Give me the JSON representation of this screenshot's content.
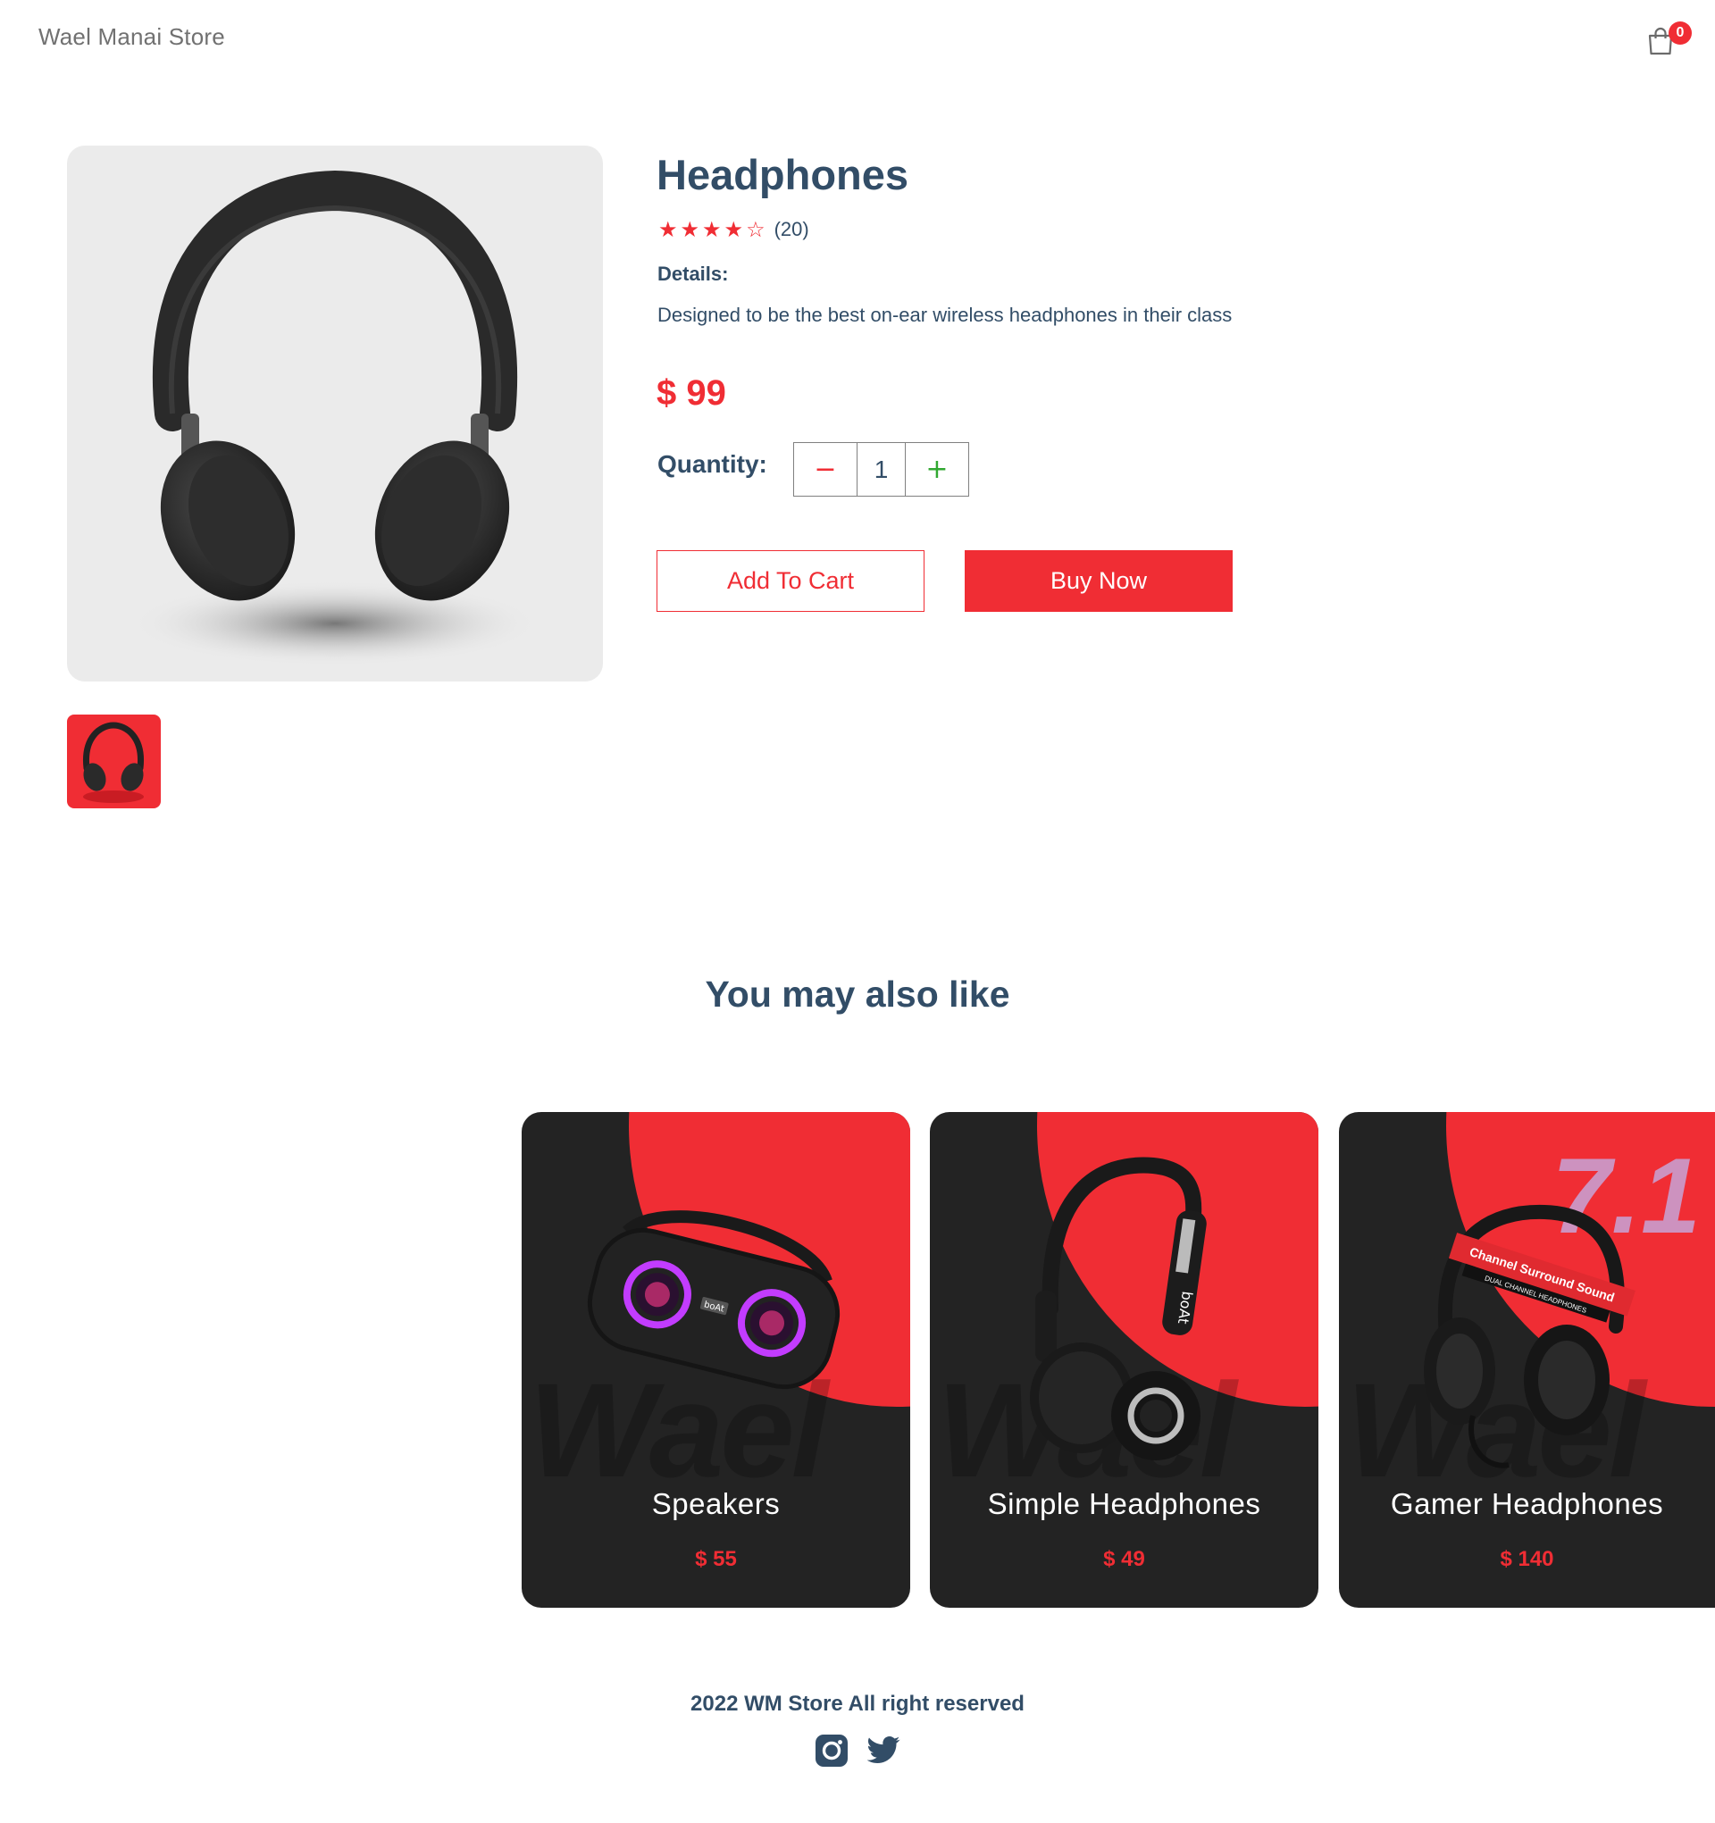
{
  "navbar": {
    "logo": "Wael Manai Store",
    "cart_count": "0"
  },
  "product": {
    "title": "Headphones",
    "rating": 4,
    "rating_max": 5,
    "review_count": "(20)",
    "details_heading": "Details:",
    "details_text": "Designed to be the best on-ear wireless headphones in their class",
    "price": "$ 99",
    "quantity_label": "Quantity:",
    "quantity_minus": "−",
    "quantity_value": "1",
    "quantity_plus": "+",
    "add_to_cart_label": "Add To Cart",
    "buy_now_label": "Buy Now"
  },
  "colors": {
    "accent": "#f02d34",
    "text": "#324d67",
    "card_bg": "#232323"
  },
  "related": {
    "heading": "You may also like",
    "watermark": "Wael",
    "items": [
      {
        "name": "Speakers",
        "price": "$ 55",
        "icon": "speaker-icon"
      },
      {
        "name": "Simple Headphones",
        "price": "$ 49",
        "icon": "headphones-icon"
      },
      {
        "name": "Gamer Headphones",
        "price": "$ 140",
        "icon": "gaming-headset-icon"
      }
    ],
    "gamer_badge_text": "7.1",
    "gamer_banner": "Channel Surround Sound",
    "gamer_banner_sub": "DUAL CHANNEL HEADPHONES",
    "boat_brand": "boAt"
  },
  "footer": {
    "text": "2022 WM Store All right reserved",
    "social": [
      "instagram-icon",
      "twitter-icon"
    ]
  }
}
